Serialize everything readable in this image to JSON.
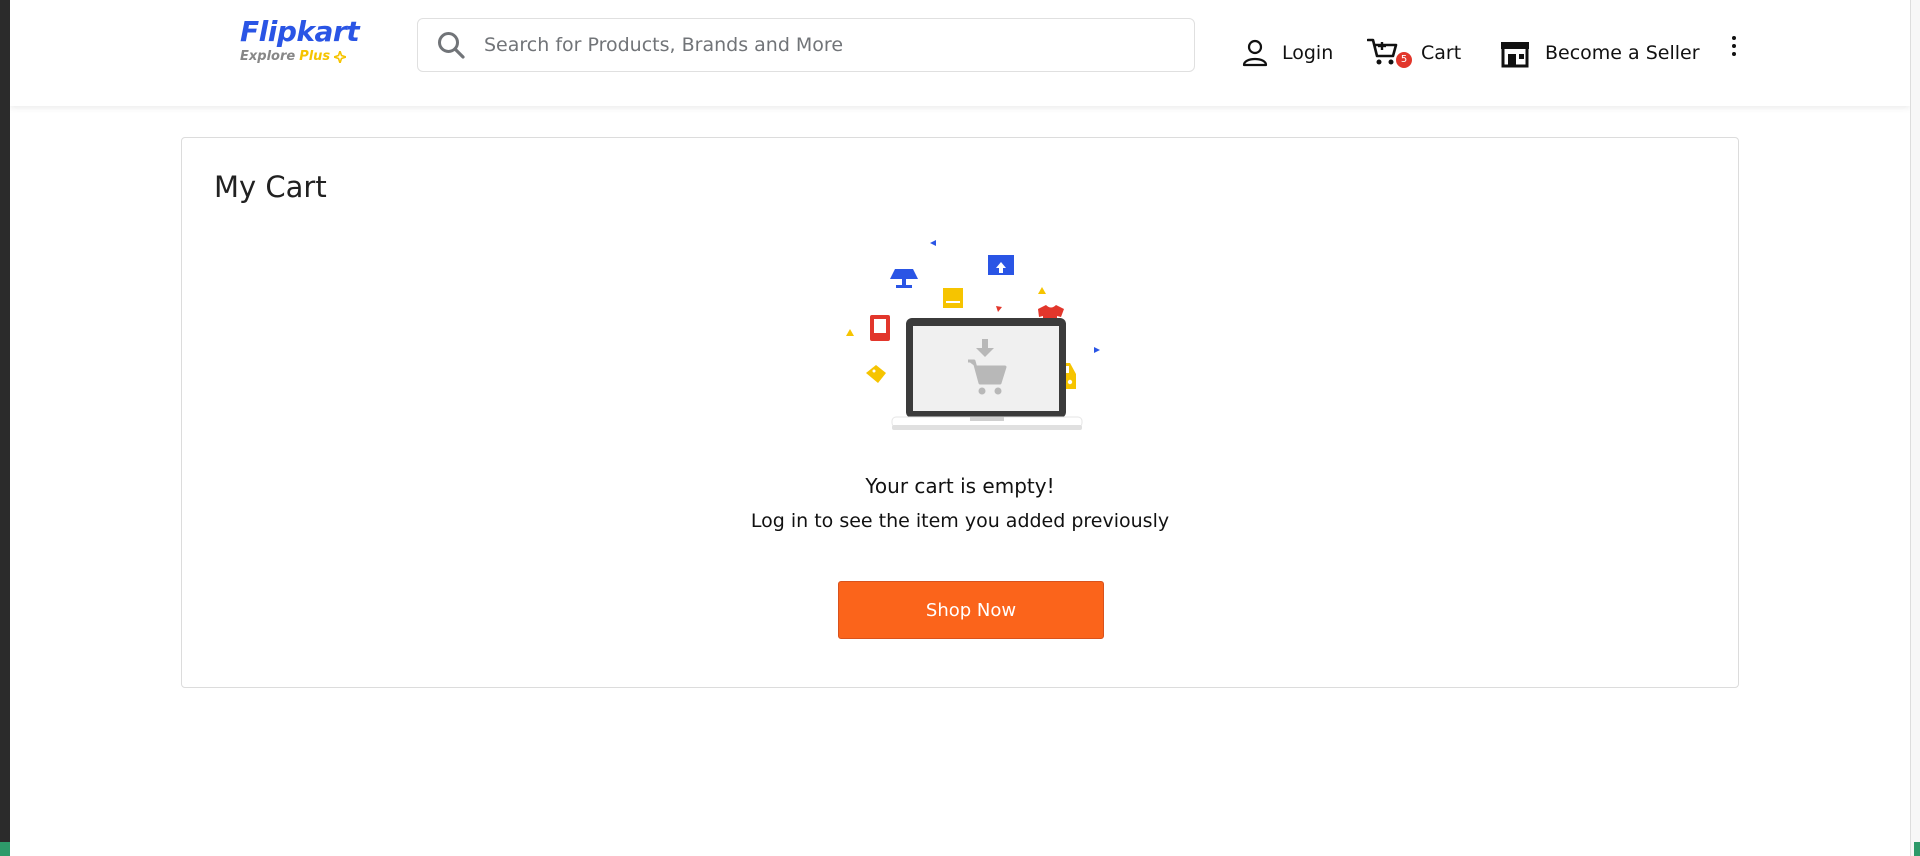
{
  "brand": {
    "name": "Flipkart",
    "sub_explore": "Explore",
    "sub_plus": "Plus",
    "color": "#2a55e5",
    "plus_color": "#f6c400"
  },
  "search": {
    "placeholder": "Search for Products, Brands and More",
    "icon": "search-icon"
  },
  "nav": {
    "login_label": "Login",
    "cart_label": "Cart",
    "cart_count": "5",
    "seller_label": "Become a Seller",
    "more_icon": "more-vertical-icon"
  },
  "cart_page": {
    "title": "My Cart",
    "empty_title": "Your cart is empty!",
    "empty_subtitle": "Log in to see the item you added previously",
    "shop_button": "Shop Now",
    "button_color": "#fb641b"
  }
}
